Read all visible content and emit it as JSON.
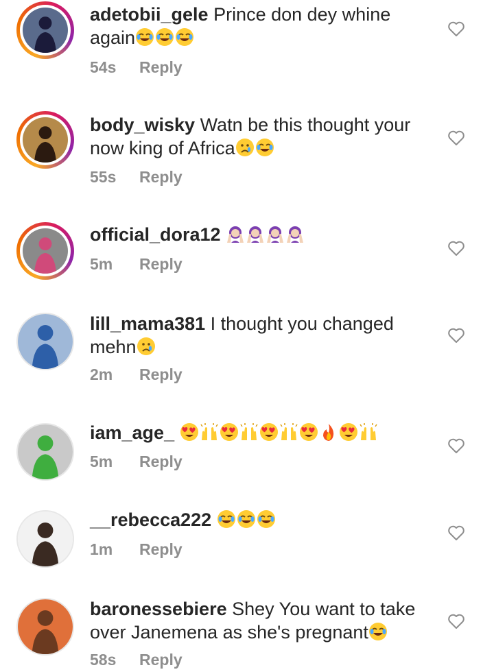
{
  "comments": [
    {
      "username": "adetobii_gele",
      "text": "Prince don dey whine again",
      "emojis": [
        "joy-emoji",
        "joy-emoji",
        "joy-emoji"
      ],
      "time": "54s",
      "reply": "Reply",
      "avatar": {
        "ring": true,
        "bg": "#5a6b8c",
        "figure": "#1b1b3a"
      }
    },
    {
      "username": "body_wisky",
      "text": "Watn be this thought your now king of Africa",
      "emojis": [
        "cry-emoji",
        "joy-emoji"
      ],
      "time": "55s",
      "reply": "Reply",
      "avatar": {
        "ring": true,
        "bg": "#b58a4a",
        "figure": "#2b1a10"
      }
    },
    {
      "username": "official_dora12",
      "text": "",
      "emojis": [
        "facepalm-emoji",
        "facepalm-emoji",
        "facepalm-emoji",
        "facepalm-emoji"
      ],
      "time": "5m",
      "reply": "Reply",
      "avatar": {
        "ring": true,
        "bg": "#8a8a8a",
        "figure": "#d04a7a"
      }
    },
    {
      "username": "lill_mama381",
      "text": "I thought you changed mehn",
      "emojis": [
        "cry-emoji"
      ],
      "time": "2m",
      "reply": "Reply",
      "avatar": {
        "ring": false,
        "bg": "#9fb8d8",
        "figure": "#2d5fa8"
      }
    },
    {
      "username": "iam_age_",
      "text": "",
      "emojis": [
        "heart-eyes-emoji",
        "raised-hands-emoji",
        "heart-eyes-emoji",
        "raised-hands-emoji",
        "heart-eyes-emoji",
        "raised-hands-emoji",
        "heart-eyes-emoji",
        "fire-emoji",
        "heart-eyes-emoji",
        "raised-hands-emoji"
      ],
      "time": "5m",
      "reply": "Reply",
      "avatar": {
        "ring": false,
        "bg": "#c9c9c9",
        "figure": "#3fae3f"
      }
    },
    {
      "username": "__rebecca222",
      "text": "",
      "emojis": [
        "joy-emoji",
        "joy-emoji",
        "joy-emoji"
      ],
      "time": "1m",
      "reply": "Reply",
      "avatar": {
        "ring": false,
        "bg": "#f2f2f2",
        "figure": "#3a2a22"
      }
    },
    {
      "username": "baronessebiere",
      "text": "Shey You want to take over Janemena as she's pregnant",
      "emojis": [
        "joy-emoji"
      ],
      "time": "58s",
      "reply": "Reply",
      "avatar": {
        "ring": false,
        "bg": "#e0703a",
        "figure": "#6b3a20"
      }
    }
  ],
  "colors": {
    "username": "#262626",
    "meta": "#8e8e8e",
    "heart": "#8e8e8e",
    "emoji_face": "#ffcc33"
  }
}
